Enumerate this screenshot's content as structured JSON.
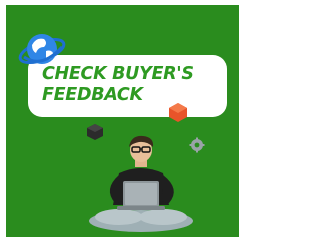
{
  "headline": {
    "line1": "CHECK BUYER'S",
    "line2": "FEEDBACK"
  },
  "colors": {
    "background": "#2a8c1e",
    "banner": "#ffffff",
    "headline_text": "#2e9a22",
    "accent_orange": "#e8542a"
  },
  "icons": [
    "globe-icon",
    "orange-cube-icon",
    "dark-cube-icon",
    "gear-icon",
    "person-with-laptop-illustration"
  ]
}
